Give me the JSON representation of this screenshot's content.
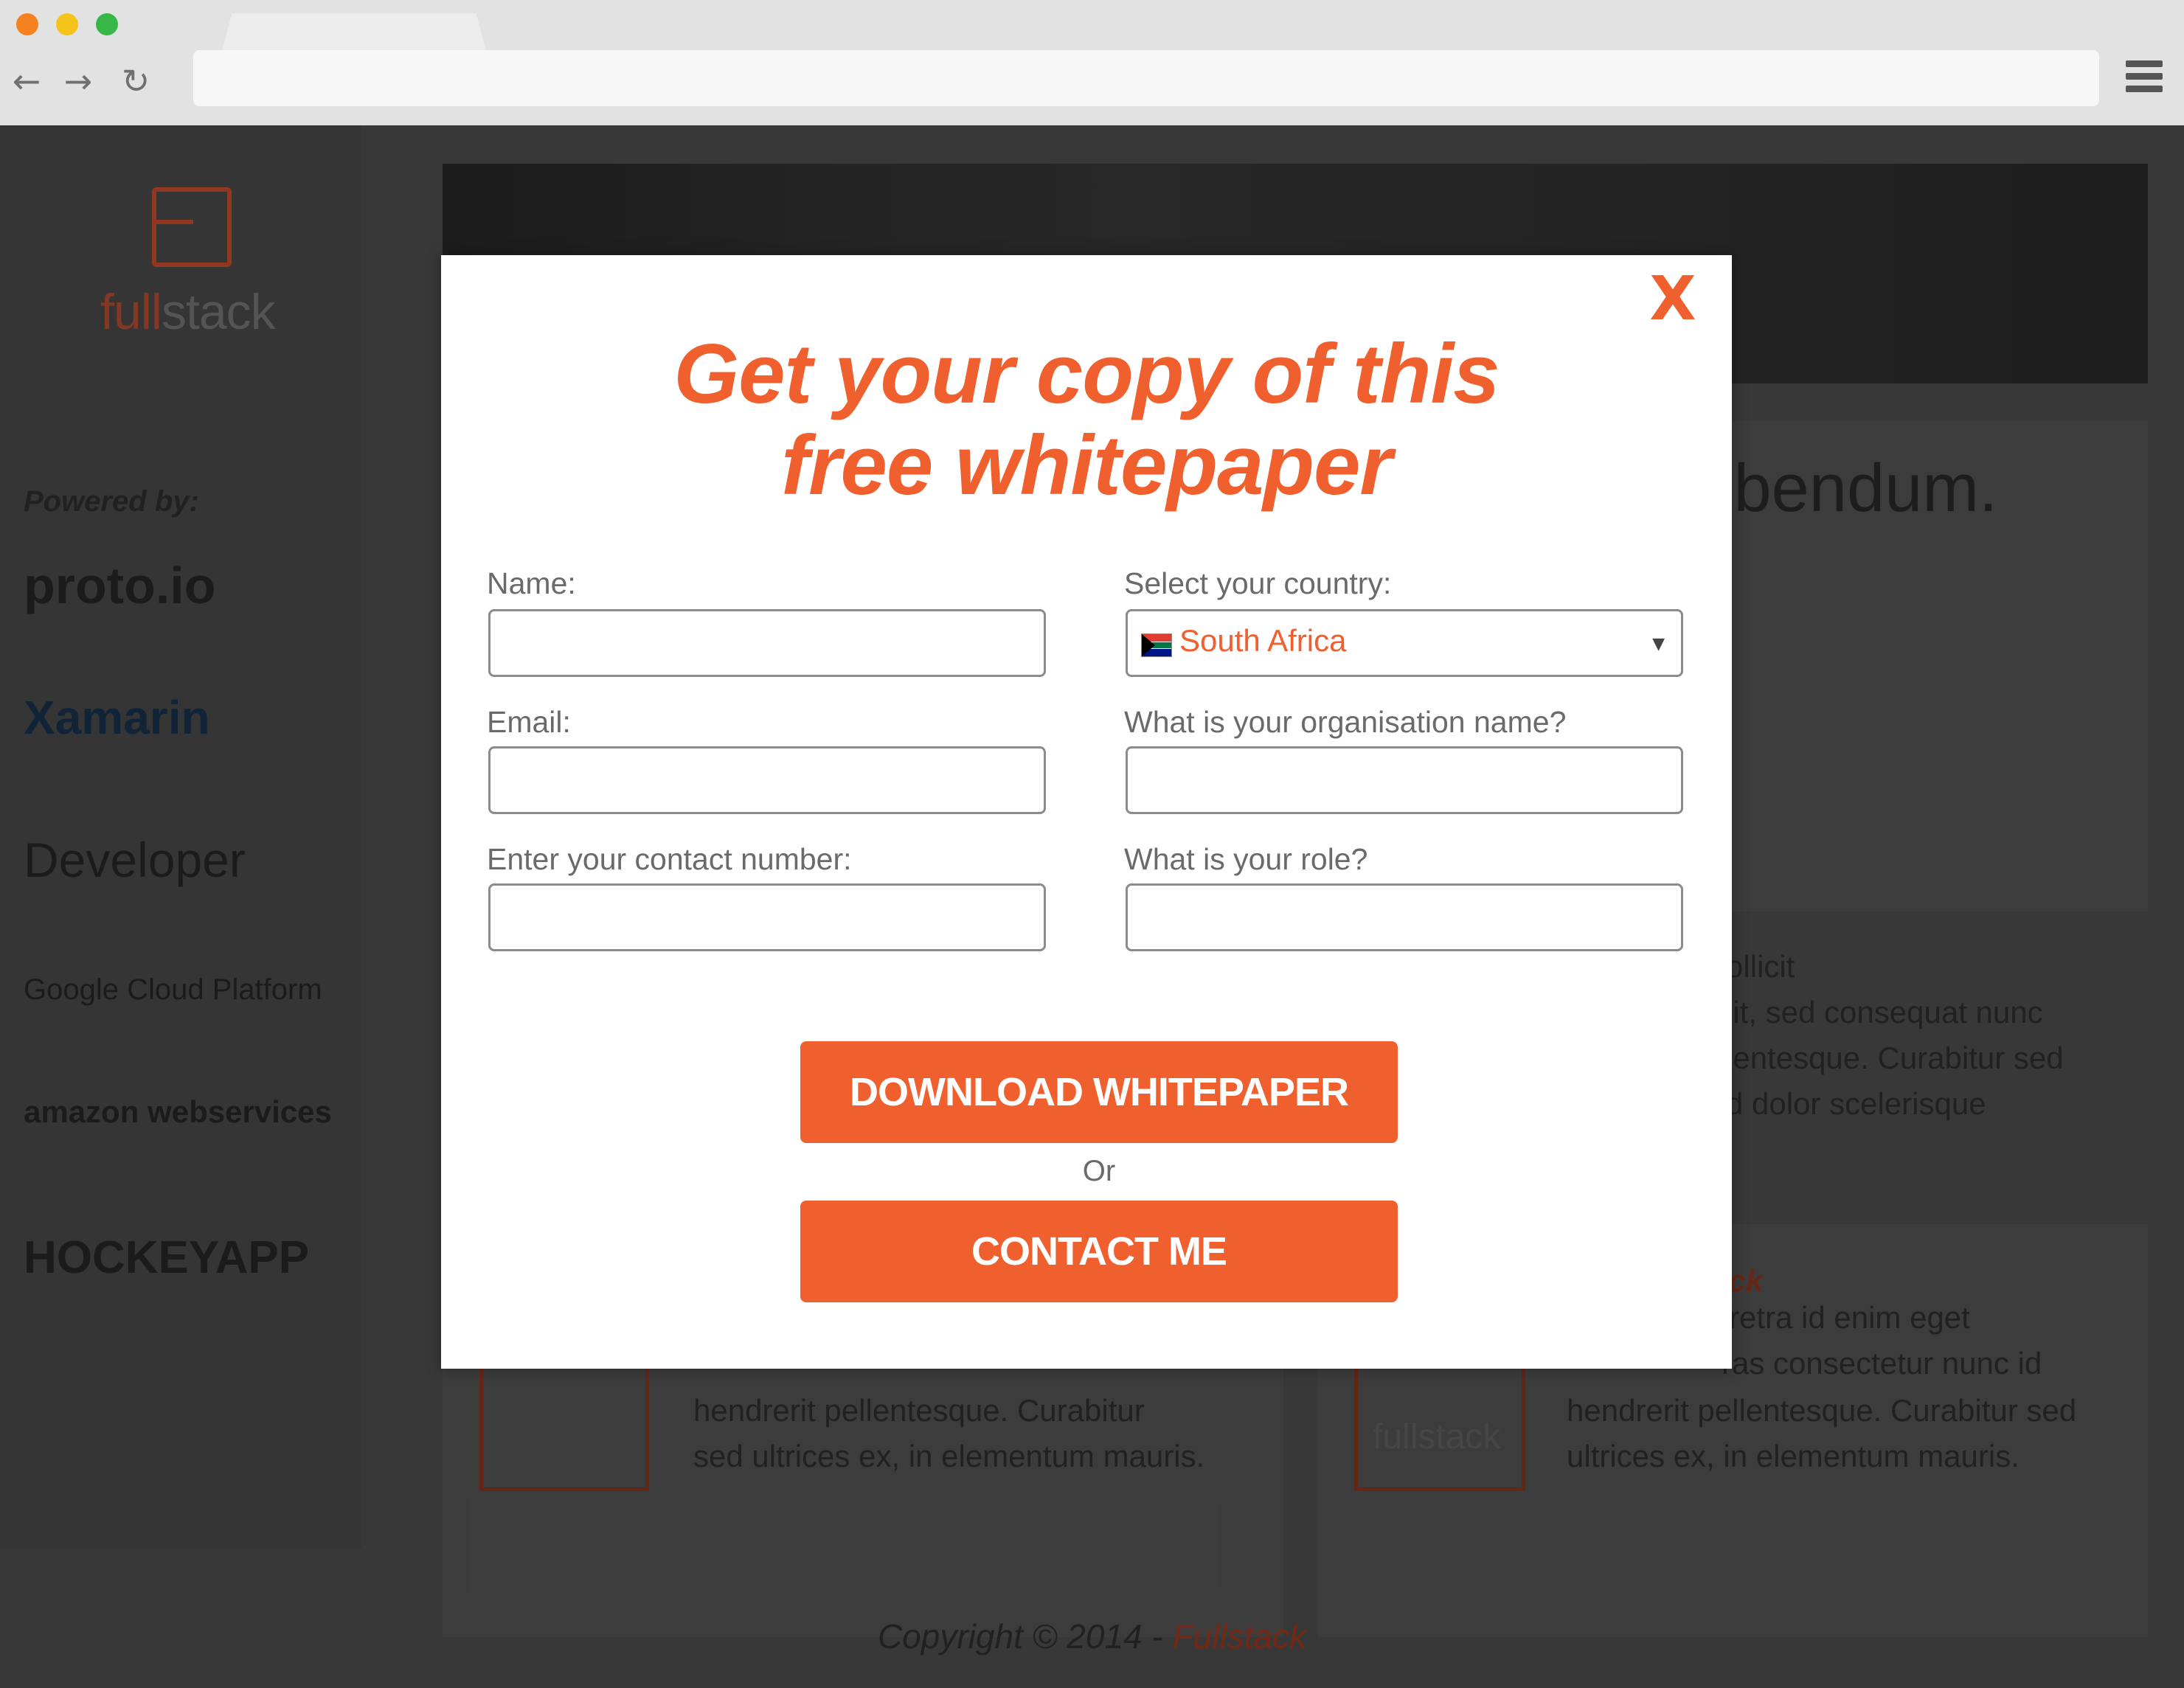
{
  "page_background": {
    "logo": {
      "word_a": "full",
      "word_b": "stack"
    },
    "powered_by": "Powered by:",
    "sponsors": [
      "proto.io",
      "Xamarin",
      "Developer",
      "Google Cloud Platform",
      "amazon webservices",
      "HOCKEYAPP"
    ],
    "heading_fragment": "ibendum.",
    "body_fragments": [
      "ollicit",
      "lit, sed consequat nunc",
      "lentesque. Curabitur sed",
      "d dolor scelerisque"
    ],
    "card_fragments": {
      "left": [
        "hendrerit pellentesque. Curabitur",
        "sed ultrices ex, in elementum mauris."
      ],
      "right_title": "ack",
      "right": [
        "retra id enim eget",
        "ras consectetur nunc id",
        "hendrerit pellentesque. Curabitur sed",
        "ultrices ex, in elementum mauris."
      ],
      "card_logo": "fullstack"
    },
    "footer_prefix": "Copyright © 2014 - ",
    "footer_brand": "Fullstack"
  },
  "modal": {
    "close_label": "X",
    "title_line1": "Get your copy of this",
    "title_line2": "free whitepaper",
    "fields": {
      "name_label": "Name:",
      "email_label": "Email:",
      "contact_label": "Enter your contact number:",
      "country_label": "Select your country:",
      "country_value": "South Africa",
      "org_label": "What is your organisation name?",
      "role_label": "What is your role?"
    },
    "download_button": "DOWNLOAD WHITEPAPER",
    "or_text": "Or",
    "contact_button": "CONTACT ME"
  },
  "colors": {
    "accent": "#f0602e",
    "overlay": "#3a3a3a"
  }
}
